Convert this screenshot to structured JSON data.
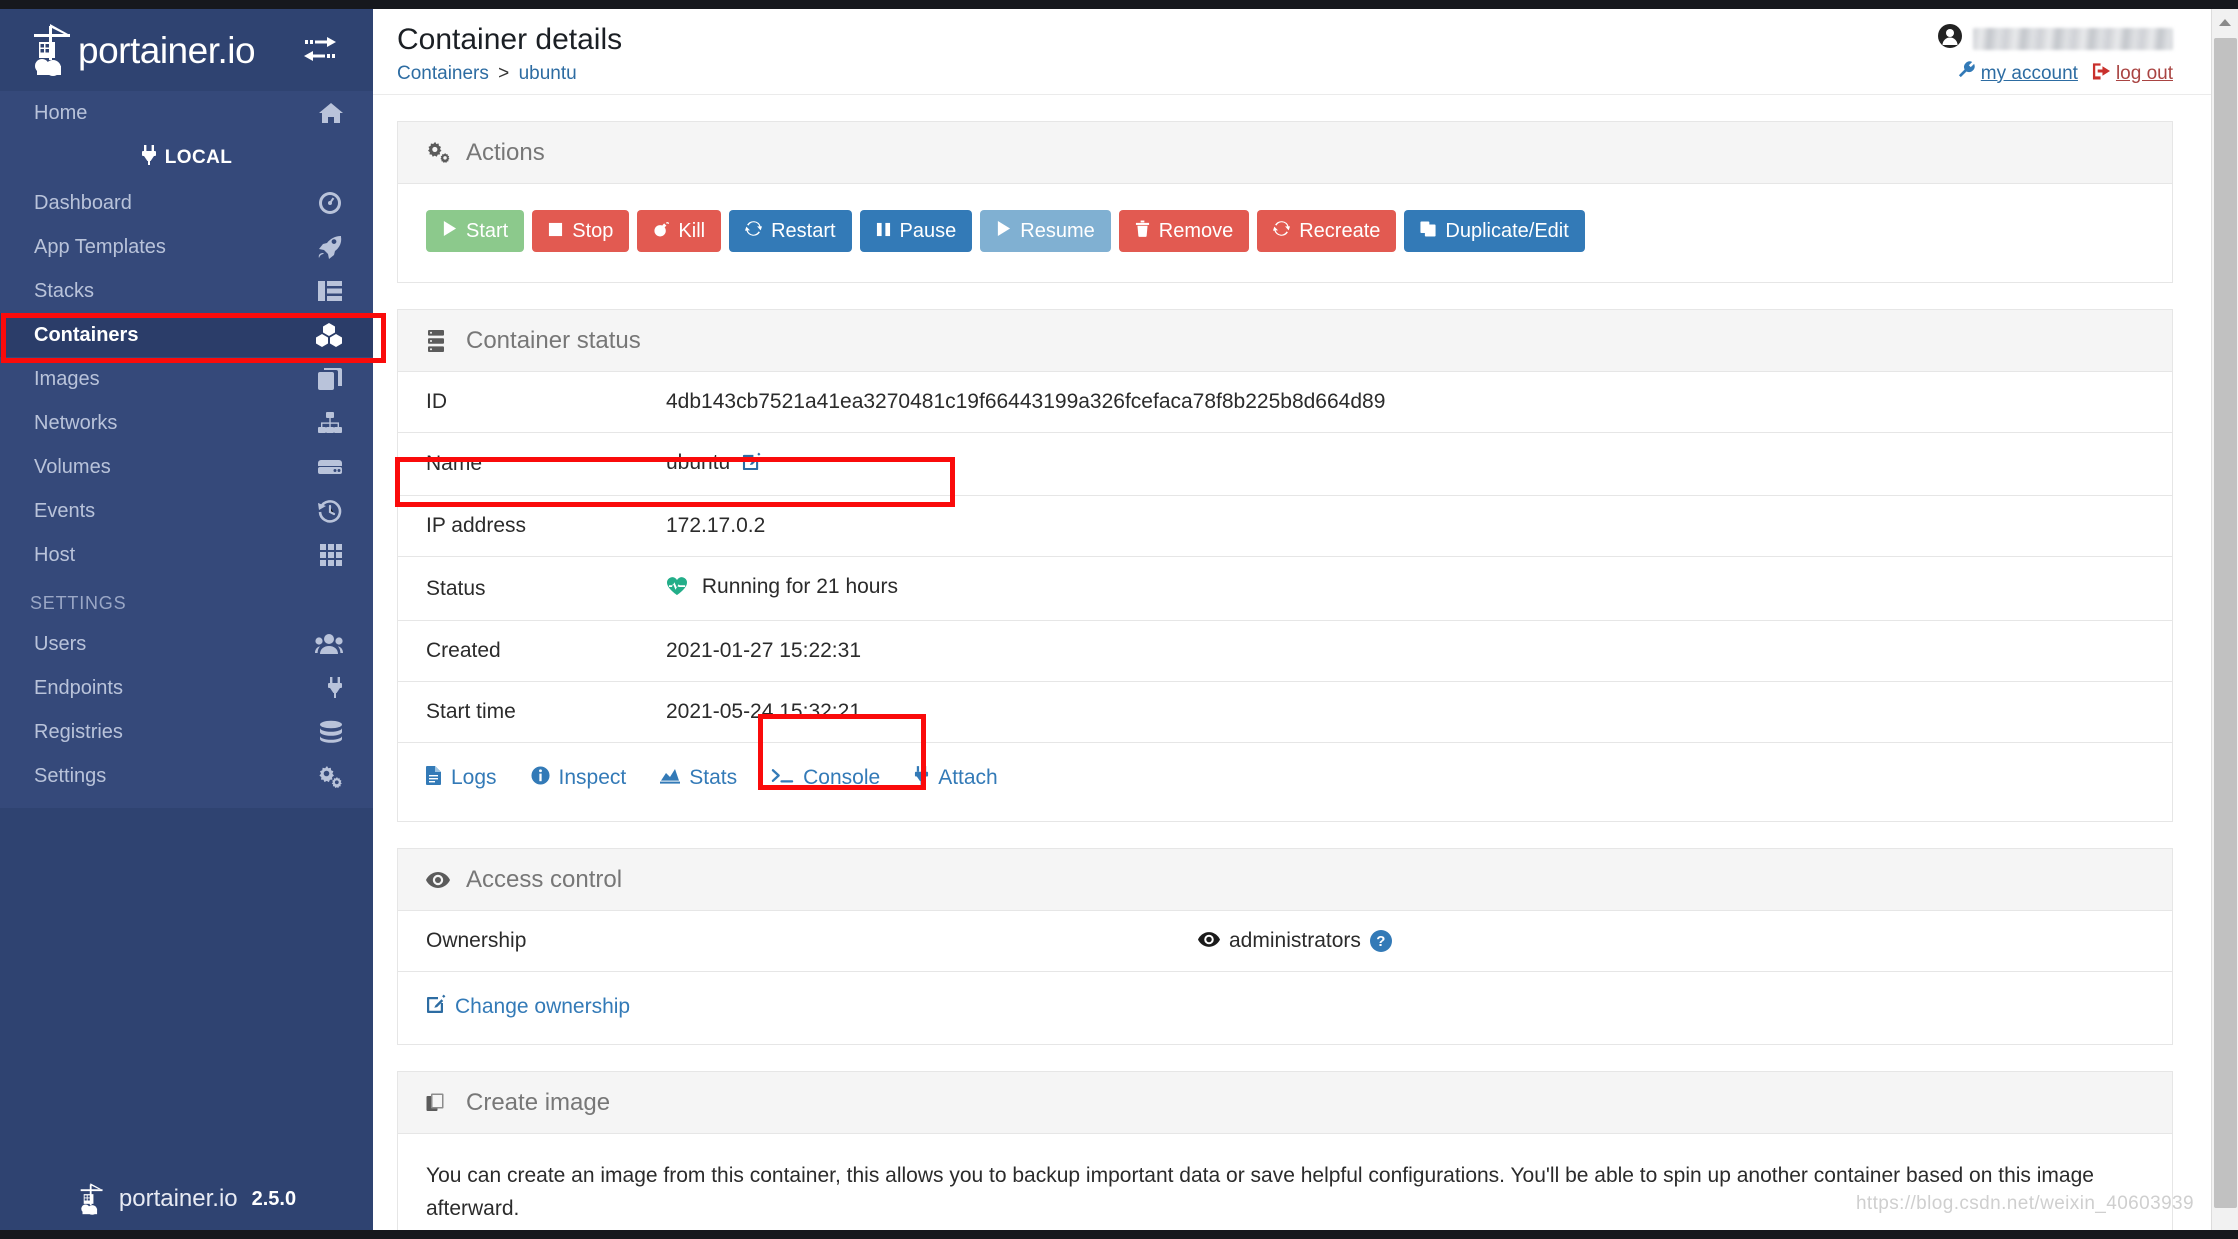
{
  "brand": {
    "name": "portainer.io",
    "version": "2.5.0",
    "toggle_icon": "toggle-sidebar-icon",
    "logo_icon": "portainer-logo-icon"
  },
  "sidebar": {
    "home": {
      "label": "Home",
      "icon": "home-icon"
    },
    "endpoint": {
      "label": "LOCAL",
      "icon": "plug-icon"
    },
    "items": [
      {
        "label": "Dashboard",
        "icon": "dashboard-icon",
        "active": false
      },
      {
        "label": "App Templates",
        "icon": "rocket-icon",
        "active": false
      },
      {
        "label": "Stacks",
        "icon": "stacks-icon",
        "active": false
      },
      {
        "label": "Containers",
        "icon": "containers-icon",
        "active": true
      },
      {
        "label": "Images",
        "icon": "images-icon",
        "active": false
      },
      {
        "label": "Networks",
        "icon": "networks-icon",
        "active": false
      },
      {
        "label": "Volumes",
        "icon": "volumes-icon",
        "active": false
      },
      {
        "label": "Events",
        "icon": "events-icon",
        "active": false
      },
      {
        "label": "Host",
        "icon": "host-icon",
        "active": false
      }
    ],
    "settings_label": "SETTINGS",
    "settings_items": [
      {
        "label": "Users",
        "icon": "users-icon"
      },
      {
        "label": "Endpoints",
        "icon": "plug-icon"
      },
      {
        "label": "Registries",
        "icon": "database-icon"
      },
      {
        "label": "Settings",
        "icon": "gears-icon"
      }
    ]
  },
  "header": {
    "title": "Container details",
    "breadcrumb": {
      "parent": "Containers",
      "separator": ">",
      "current": "ubuntu"
    },
    "account_link": "my account",
    "logout_link": "log out",
    "account_icon": "wrench-icon",
    "logout_icon": "signout-icon",
    "avatar_icon": "user-avatar-icon"
  },
  "actions_panel": {
    "title": "Actions",
    "icon": "gears-icon",
    "buttons": [
      {
        "label": "Start",
        "style": "success",
        "icon": "play-icon"
      },
      {
        "label": "Stop",
        "style": "danger",
        "icon": "stop-icon"
      },
      {
        "label": "Kill",
        "style": "danger",
        "icon": "bomb-icon"
      },
      {
        "label": "Restart",
        "style": "primary",
        "icon": "refresh-icon"
      },
      {
        "label": "Pause",
        "style": "primary",
        "icon": "pause-icon"
      },
      {
        "label": "Resume",
        "style": "info",
        "icon": "play-icon"
      },
      {
        "label": "Remove",
        "style": "danger",
        "icon": "trash-icon"
      },
      {
        "label": "Recreate",
        "style": "danger",
        "icon": "refresh-icon"
      },
      {
        "label": "Duplicate/Edit",
        "style": "primary",
        "icon": "copy-icon"
      }
    ]
  },
  "status_panel": {
    "title": "Container status",
    "icon": "server-icon",
    "rows": [
      {
        "key": "ID",
        "value": "4db143cb7521a41ea3270481c19f66443199a326fcefaca78f8b225b8d664d89"
      },
      {
        "key": "Name",
        "value": "ubuntu",
        "editable": true
      },
      {
        "key": "IP address",
        "value": "172.17.0.2"
      },
      {
        "key": "Status",
        "value": "Running for 21 hours",
        "icon": "heartbeat-icon"
      },
      {
        "key": "Created",
        "value": "2021-01-27 15:22:31"
      },
      {
        "key": "Start time",
        "value": "2021-05-24 15:32:21"
      }
    ],
    "links": [
      {
        "label": "Logs",
        "icon": "file-icon"
      },
      {
        "label": "Inspect",
        "icon": "info-icon"
      },
      {
        "label": "Stats",
        "icon": "chart-icon"
      },
      {
        "label": "Console",
        "icon": "terminal-icon"
      },
      {
        "label": "Attach",
        "icon": "plug-icon"
      }
    ]
  },
  "access_panel": {
    "title": "Access control",
    "icon": "eye-icon",
    "ownership_label": "Ownership",
    "ownership_value": "administrators",
    "ownership_icon": "eye-icon",
    "help_badge": "?",
    "change_ownership_label": "Change ownership",
    "change_ownership_icon": "edit-icon"
  },
  "create_image_panel": {
    "title": "Create image",
    "icon": "clone-icon",
    "description": "You can create an image from this container, this allows you to backup important data or save helpful configurations. You'll be able to spin up another container based on this image afterward."
  },
  "watermark": "https://blog.csdn.net/weixin_40603939",
  "colors": {
    "sidebar_bg": "#2f4371",
    "sidebar_list_bg": "#35497a",
    "sidebar_active_bg": "#2b3d69",
    "highlight_red": "#fa0b0b",
    "primary_blue": "#337ab7",
    "danger_red": "#e25a51",
    "success_green": "#8cc98c",
    "info_blue": "#80b0d2",
    "link_blue": "#2d6ca2",
    "status_green": "#23ae89"
  }
}
